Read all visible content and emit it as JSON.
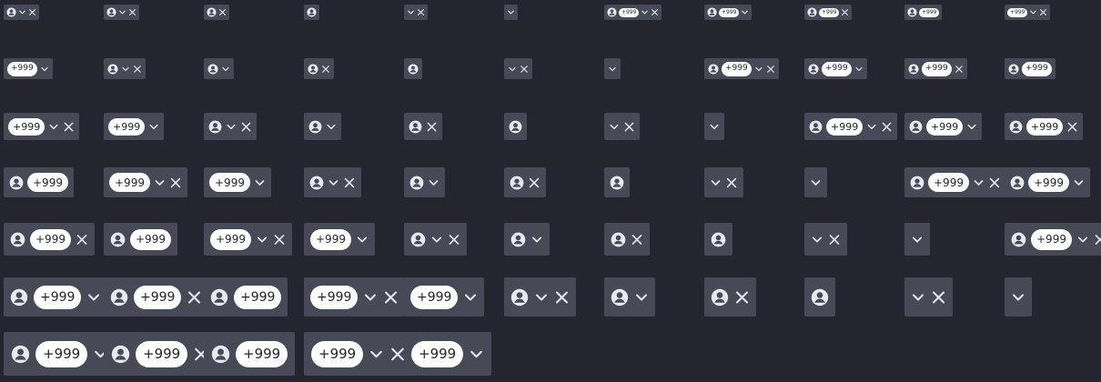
{
  "badge_label": "+999",
  "colors": {
    "background": "#24252f",
    "chip": "#474a56",
    "icon": "#e8e9ee",
    "badge_bg": "#ffffff",
    "badge_text": "#24252f"
  },
  "chip_parts": {
    "a": "avatar-icon",
    "b": "count-badge",
    "d": "chevron-down-icon",
    "x": "close-icon"
  },
  "grid": {
    "columns": 11,
    "rows": [
      [
        "adx",
        "adx",
        "ax",
        "a",
        "dx",
        "d",
        "abdx",
        "abd",
        "abx",
        "ab",
        "bdx"
      ],
      [
        "bd",
        "adx",
        "ad",
        "ax",
        "a",
        "dx",
        "d",
        "abdx",
        "abd",
        "abx",
        "ab"
      ],
      [
        "bdx",
        "bd",
        "adx",
        "ad",
        "ax",
        "a",
        "dx",
        "d",
        "abdx",
        "abd",
        "abx"
      ],
      [
        "ab",
        "bdx",
        "bd",
        "adx",
        "ad",
        "ax",
        "a",
        "dx",
        "d",
        "abdx",
        "abd"
      ],
      [
        "abx",
        "ab",
        "bdx",
        "bd",
        "adx",
        "ad",
        "ax",
        "a",
        "dx",
        "d",
        "abdx"
      ],
      [
        "abd",
        "abx",
        "ab",
        "bdx",
        "bd",
        "adx",
        "ad",
        "ax",
        "a",
        "dx",
        "d"
      ],
      [
        "abd",
        "abx",
        "ab",
        "bdx",
        "bd"
      ]
    ]
  }
}
